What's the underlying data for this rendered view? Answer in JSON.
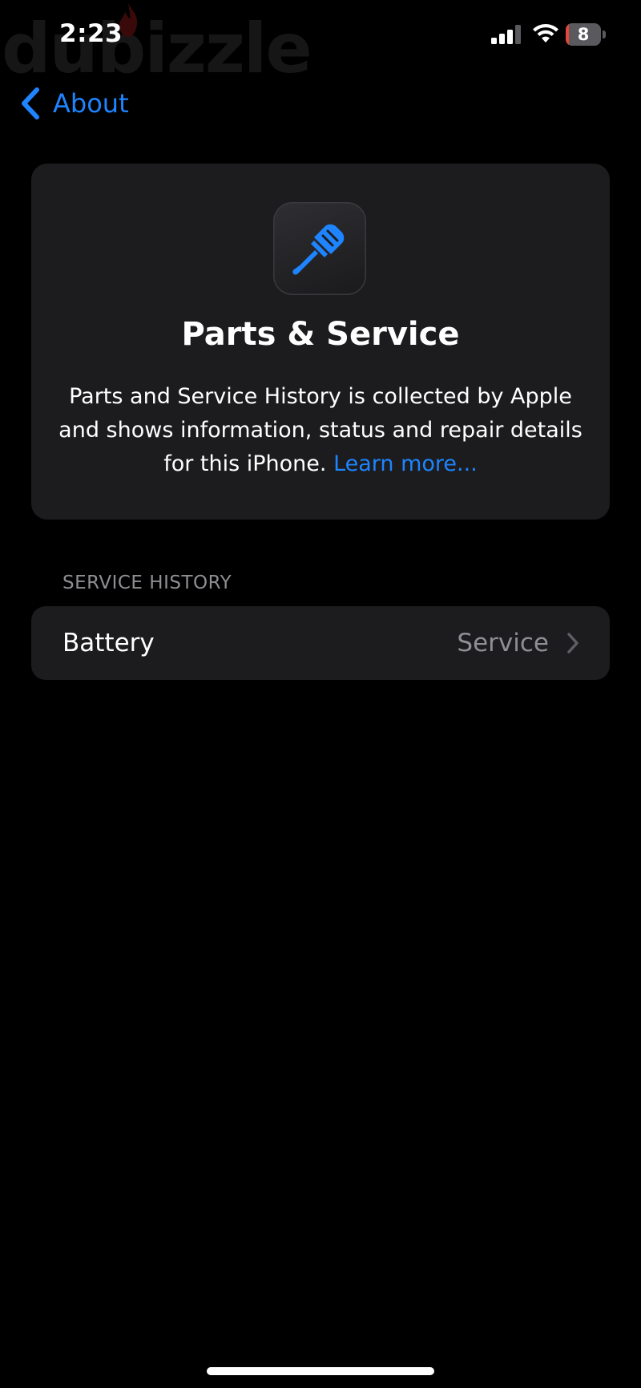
{
  "watermark": {
    "text": "dubizzle"
  },
  "status_bar": {
    "time": "2:23",
    "signal_icon": "cellular-signal-icon",
    "wifi_icon": "wifi-icon",
    "battery_icon": "battery-icon",
    "battery_level": "8",
    "battery_fraction": 0.08
  },
  "nav": {
    "back_icon": "chevron-left-icon",
    "back_label": "About"
  },
  "info_card": {
    "icon": "screwdriver-icon",
    "title": "Parts & Service",
    "description": "Parts and Service History is collected by Apple and shows information, status and repair details for this iPhone.",
    "link_label": "Learn more..."
  },
  "service_history": {
    "header": "SERVICE HISTORY",
    "rows": [
      {
        "label": "Battery",
        "value": "Service",
        "icon": "chevron-right-icon"
      }
    ]
  },
  "colors": {
    "background": "#000000",
    "card": "#1c1c1e",
    "accent_blue": "#1e84ff",
    "secondary_text": "#8e8e93",
    "battery_low": "#e5453a"
  }
}
